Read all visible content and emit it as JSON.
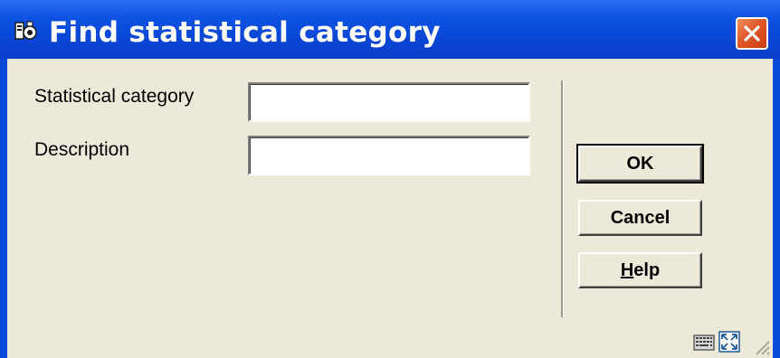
{
  "window": {
    "title": "Find statistical category",
    "title_icon": "app-icon",
    "close_icon": "close-icon",
    "colors": {
      "titlebar": "#0845d4",
      "client": "#ece9d8",
      "close": "#e0582a"
    }
  },
  "form": {
    "fields": [
      {
        "label": "Statistical category",
        "value": ""
      },
      {
        "label": "Description",
        "value": ""
      }
    ]
  },
  "buttons": {
    "ok": "OK",
    "cancel": "Cancel",
    "help_mnemonic": "H",
    "help_rest": "elp"
  },
  "statusbar": {
    "icons": [
      "keyboard-icon",
      "resize-window-icon",
      "size-grip-icon"
    ]
  }
}
